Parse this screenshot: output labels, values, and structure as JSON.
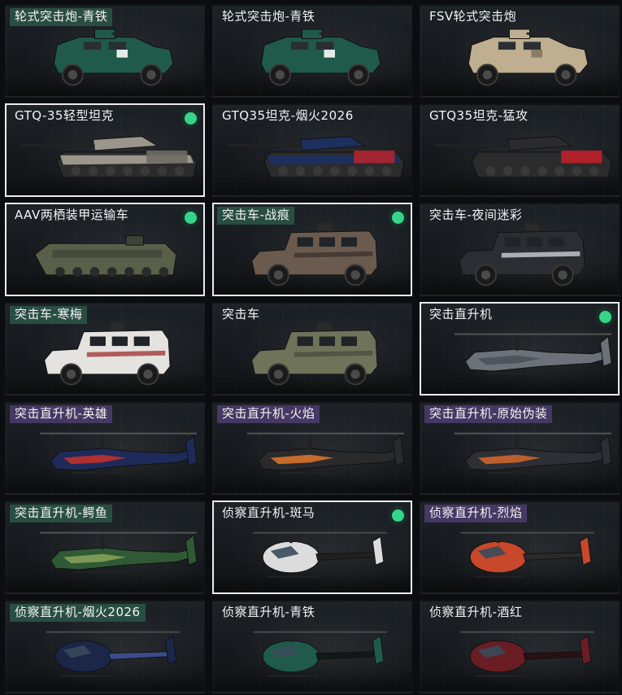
{
  "colors": {
    "selected_border": "#e9ecee",
    "owned_dot": "#34d58a",
    "tag_green": "#2c5646",
    "tag_purple": "#4e3c6e"
  },
  "cards": [
    {
      "name": "轮式突击炮-青铁",
      "kind": "armored-car",
      "tag": "green",
      "selected": false,
      "owned": false,
      "colors": [
        "#1f5a4b",
        "#e6ebe8"
      ]
    },
    {
      "name": "轮式突击炮-青铁",
      "kind": "armored-car",
      "tag": "none",
      "selected": false,
      "owned": false,
      "colors": [
        "#1f5a4b",
        "#e6ebe8"
      ]
    },
    {
      "name": "FSV轮式突击炮",
      "kind": "armored-car",
      "tag": "none",
      "selected": false,
      "owned": false,
      "colors": [
        "#bfae8f",
        "#8a7d66"
      ]
    },
    {
      "name": "GTQ-35轻型坦克",
      "kind": "tank",
      "tag": "none",
      "selected": true,
      "owned": true,
      "colors": [
        "#9a968c",
        "#6f6b63"
      ]
    },
    {
      "name": "GTQ35坦克-烟火2026",
      "kind": "tank",
      "tag": "none",
      "selected": false,
      "owned": false,
      "colors": [
        "#1d2f5c",
        "#b3232d"
      ]
    },
    {
      "name": "GTQ35坦克-猛攻",
      "kind": "tank",
      "tag": "none",
      "selected": false,
      "owned": false,
      "colors": [
        "#2b2b2e",
        "#c0202a"
      ]
    },
    {
      "name": "AAV两栖装甲运输车",
      "kind": "apc",
      "tag": "none",
      "selected": true,
      "owned": true,
      "colors": [
        "#5a5f4a",
        "#3f4336"
      ]
    },
    {
      "name": "突击车-战痕",
      "kind": "mrap",
      "tag": "green",
      "selected": true,
      "owned": true,
      "colors": [
        "#6b5a4e",
        "#3e3530"
      ]
    },
    {
      "name": "突击车-夜间迷彩",
      "kind": "mrap",
      "tag": "none",
      "selected": false,
      "owned": false,
      "colors": [
        "#2a2d31",
        "#c9cfd5"
      ]
    },
    {
      "name": "突击车-寒梅",
      "kind": "mrap",
      "tag": "green",
      "selected": false,
      "owned": false,
      "colors": [
        "#e5e3e0",
        "#a33a3a"
      ]
    },
    {
      "name": "突击车",
      "kind": "mrap",
      "tag": "none",
      "selected": false,
      "owned": false,
      "colors": [
        "#6f735a",
        "#4a4d3c"
      ]
    },
    {
      "name": "突击直升机",
      "kind": "attack-heli",
      "tag": "none",
      "selected": true,
      "owned": true,
      "colors": [
        "#6c7279",
        "#4a4f55"
      ]
    },
    {
      "name": "突击直升机-英雄",
      "kind": "attack-heli",
      "tag": "purple",
      "selected": false,
      "owned": false,
      "colors": [
        "#1e2a5a",
        "#c8312a"
      ]
    },
    {
      "name": "突击直升机-火焰",
      "kind": "attack-heli",
      "tag": "purple",
      "selected": false,
      "owned": false,
      "colors": [
        "#2a2a2c",
        "#e0782b"
      ]
    },
    {
      "name": "突击直升机-原始伪装",
      "kind": "attack-heli",
      "tag": "purple",
      "selected": false,
      "owned": false,
      "colors": [
        "#2d2f36",
        "#d5672a"
      ]
    },
    {
      "name": "突击直升机-鳄鱼",
      "kind": "attack-heli",
      "tag": "green",
      "selected": false,
      "owned": false,
      "colors": [
        "#2f5a35",
        "#8aa35a"
      ]
    },
    {
      "name": "侦察直升机-斑马",
      "kind": "scout-heli",
      "tag": "none",
      "selected": true,
      "owned": true,
      "colors": [
        "#dcdcdc",
        "#202020"
      ]
    },
    {
      "name": "侦察直升机-烈焰",
      "kind": "scout-heli",
      "tag": "purple",
      "selected": false,
      "owned": false,
      "colors": [
        "#c7482a",
        "#2a2a2a"
      ]
    },
    {
      "name": "侦察直升机-烟火2026",
      "kind": "scout-heli",
      "tag": "green",
      "selected": false,
      "owned": false,
      "colors": [
        "#1b2648",
        "#3a4c8a"
      ]
    },
    {
      "name": "侦察直升机-青铁",
      "kind": "scout-heli",
      "tag": "none",
      "selected": false,
      "owned": false,
      "colors": [
        "#1f5a4b",
        "#0f1a18"
      ]
    },
    {
      "name": "侦察直升机-酒红",
      "kind": "scout-heli",
      "tag": "none",
      "selected": false,
      "owned": false,
      "colors": [
        "#6b1d24",
        "#2a1013"
      ]
    }
  ]
}
